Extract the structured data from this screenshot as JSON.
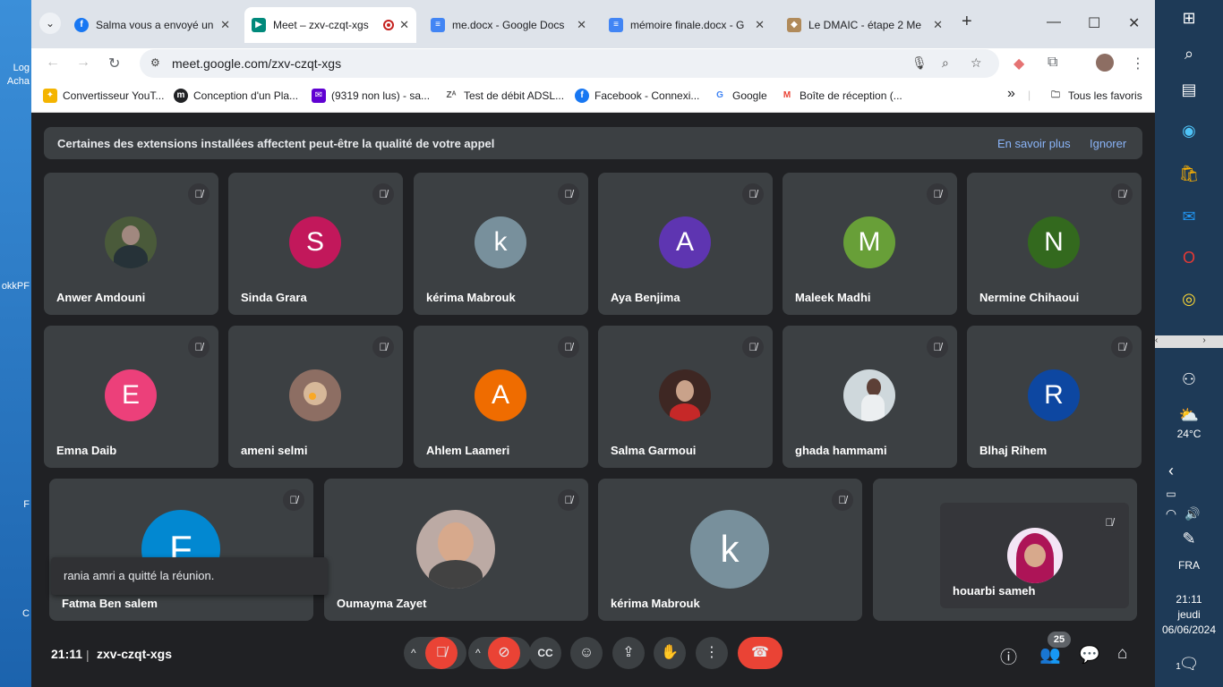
{
  "desktop": {
    "labels": [
      "Log",
      "Acha",
      "okkPF",
      "F",
      "C"
    ]
  },
  "browser": {
    "tabs": [
      {
        "title": "Salma vous a envoyé un",
        "icon": "facebook-icon",
        "color": "#1877f2",
        "active": false
      },
      {
        "title": "Meet – zxv-czqt-xgs",
        "icon": "meet-icon",
        "color": "#00897b",
        "active": true
      },
      {
        "title": "me.docx - Google Docs",
        "icon": "docs-icon",
        "color": "#4285f4",
        "active": false
      },
      {
        "title": "mémoire finale.docx - G",
        "icon": "docs-icon",
        "color": "#4285f4",
        "active": false
      },
      {
        "title": "Le DMAIC - étape 2 Me",
        "icon": "site-icon",
        "color": "#b08a5a",
        "active": false
      }
    ],
    "url": "meet.google.com/zxv-czqt-xgs",
    "bookmarks": [
      {
        "label": "Convertisseur YouT...",
        "icon": "converter-icon",
        "color": "#f4b400"
      },
      {
        "label": "Conception d'un Pla...",
        "icon": "m-icon",
        "color": "#202124"
      },
      {
        "label": "(9319 non lus) - sa...",
        "icon": "mail-icon",
        "color": "#6001d2"
      },
      {
        "label": "Test de débit ADSL...",
        "icon": "za-icon",
        "color": "#555555"
      },
      {
        "label": "Facebook - Connexi...",
        "icon": "facebook-icon",
        "color": "#1877f2"
      },
      {
        "label": "Google",
        "icon": "google-icon",
        "color": "#4285f4"
      },
      {
        "label": "Boîte de réception (...",
        "icon": "gmail-icon",
        "color": "#ea4335"
      }
    ],
    "all_bookmarks": "Tous les favoris",
    "overflow": "»"
  },
  "meet": {
    "banner": {
      "message": "Certaines des extensions installées affectent peut-être la qualité de votre appel",
      "learn_more": "En savoir plus",
      "dismiss": "Ignorer"
    },
    "participants": [
      {
        "name": "Anwer Amdouni",
        "initial": "",
        "color": "#4a5a3a"
      },
      {
        "name": "Sinda Grara",
        "initial": "S",
        "color": "#c2185b"
      },
      {
        "name": "kérima Mabrouk",
        "initial": "k",
        "color": "#78909c"
      },
      {
        "name": "Aya Benjima",
        "initial": "A",
        "color": "#5e35b1"
      },
      {
        "name": "Maleek Madhi",
        "initial": "M",
        "color": "#689f38"
      },
      {
        "name": "Nermine Chihaoui",
        "initial": "N",
        "color": "#33691e"
      },
      {
        "name": "Emna Daib",
        "initial": "E",
        "color": "#ec407a"
      },
      {
        "name": "ameni selmi",
        "initial": "",
        "color": "#8d6e63"
      },
      {
        "name": "Ahlem Laameri",
        "initial": "A",
        "color": "#ef6c00"
      },
      {
        "name": "Salma Garmoui",
        "initial": "",
        "color": "#5d4037"
      },
      {
        "name": "ghada hammami",
        "initial": "",
        "color": "#cfd8dc"
      },
      {
        "name": "Blhaj Rihem",
        "initial": "R",
        "color": "#0d47a1"
      },
      {
        "name": "Fatma Ben salem",
        "initial": "F",
        "color": "#0288d1"
      },
      {
        "name": "Oumayma Zayet",
        "initial": "",
        "color": "#bcaaa4"
      },
      {
        "name": "kérima Mabrouk",
        "initial": "k",
        "color": "#78909c"
      },
      {
        "name": "houarbi sameh",
        "initial": "",
        "color": "#e1bee7"
      }
    ],
    "toast": "rania amri a quitté la réunion.",
    "time": "21:11",
    "meeting_code": "zxv-czqt-xgs",
    "participant_count": "25"
  },
  "taskbar": {
    "temperature": "24°C",
    "language": "FRA",
    "time": "21:11",
    "day": "jeudi",
    "date": "06/06/2024",
    "notifications": "1"
  }
}
